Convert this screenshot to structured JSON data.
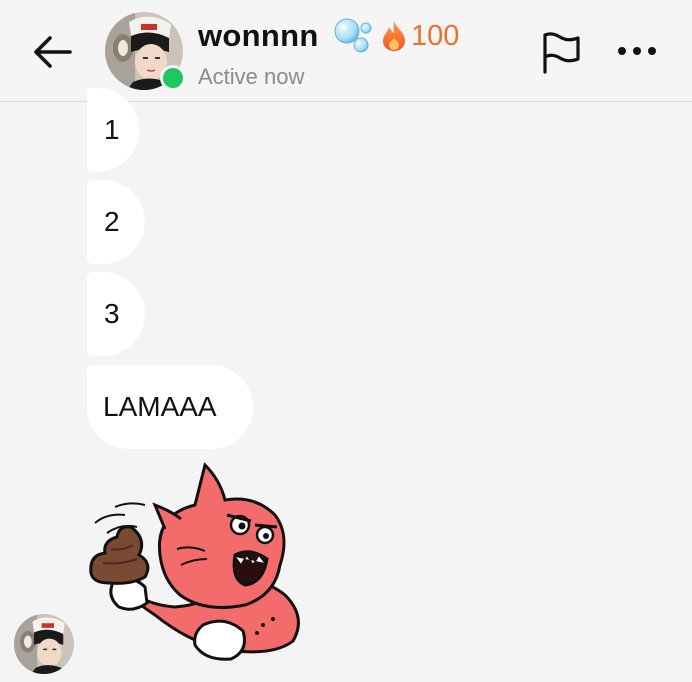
{
  "header": {
    "username": "wonnnn",
    "streak_count": "100",
    "status": "Active now",
    "icons": [
      "back-arrow-icon",
      "bubbles-icon",
      "flame-icon",
      "flag-icon",
      "more-icon"
    ]
  },
  "messages": [
    {
      "text": "1"
    },
    {
      "text": "2"
    },
    {
      "text": "3"
    },
    {
      "text": "LAMAAA"
    }
  ],
  "sticker": {
    "name": "red-cat-with-poop-sticker"
  },
  "colors": {
    "background": "#f4f4f4",
    "bubble": "#ffffff",
    "online": "#1ec760",
    "streak": "#f0702b",
    "sticker_cat": "#f36b6b"
  }
}
